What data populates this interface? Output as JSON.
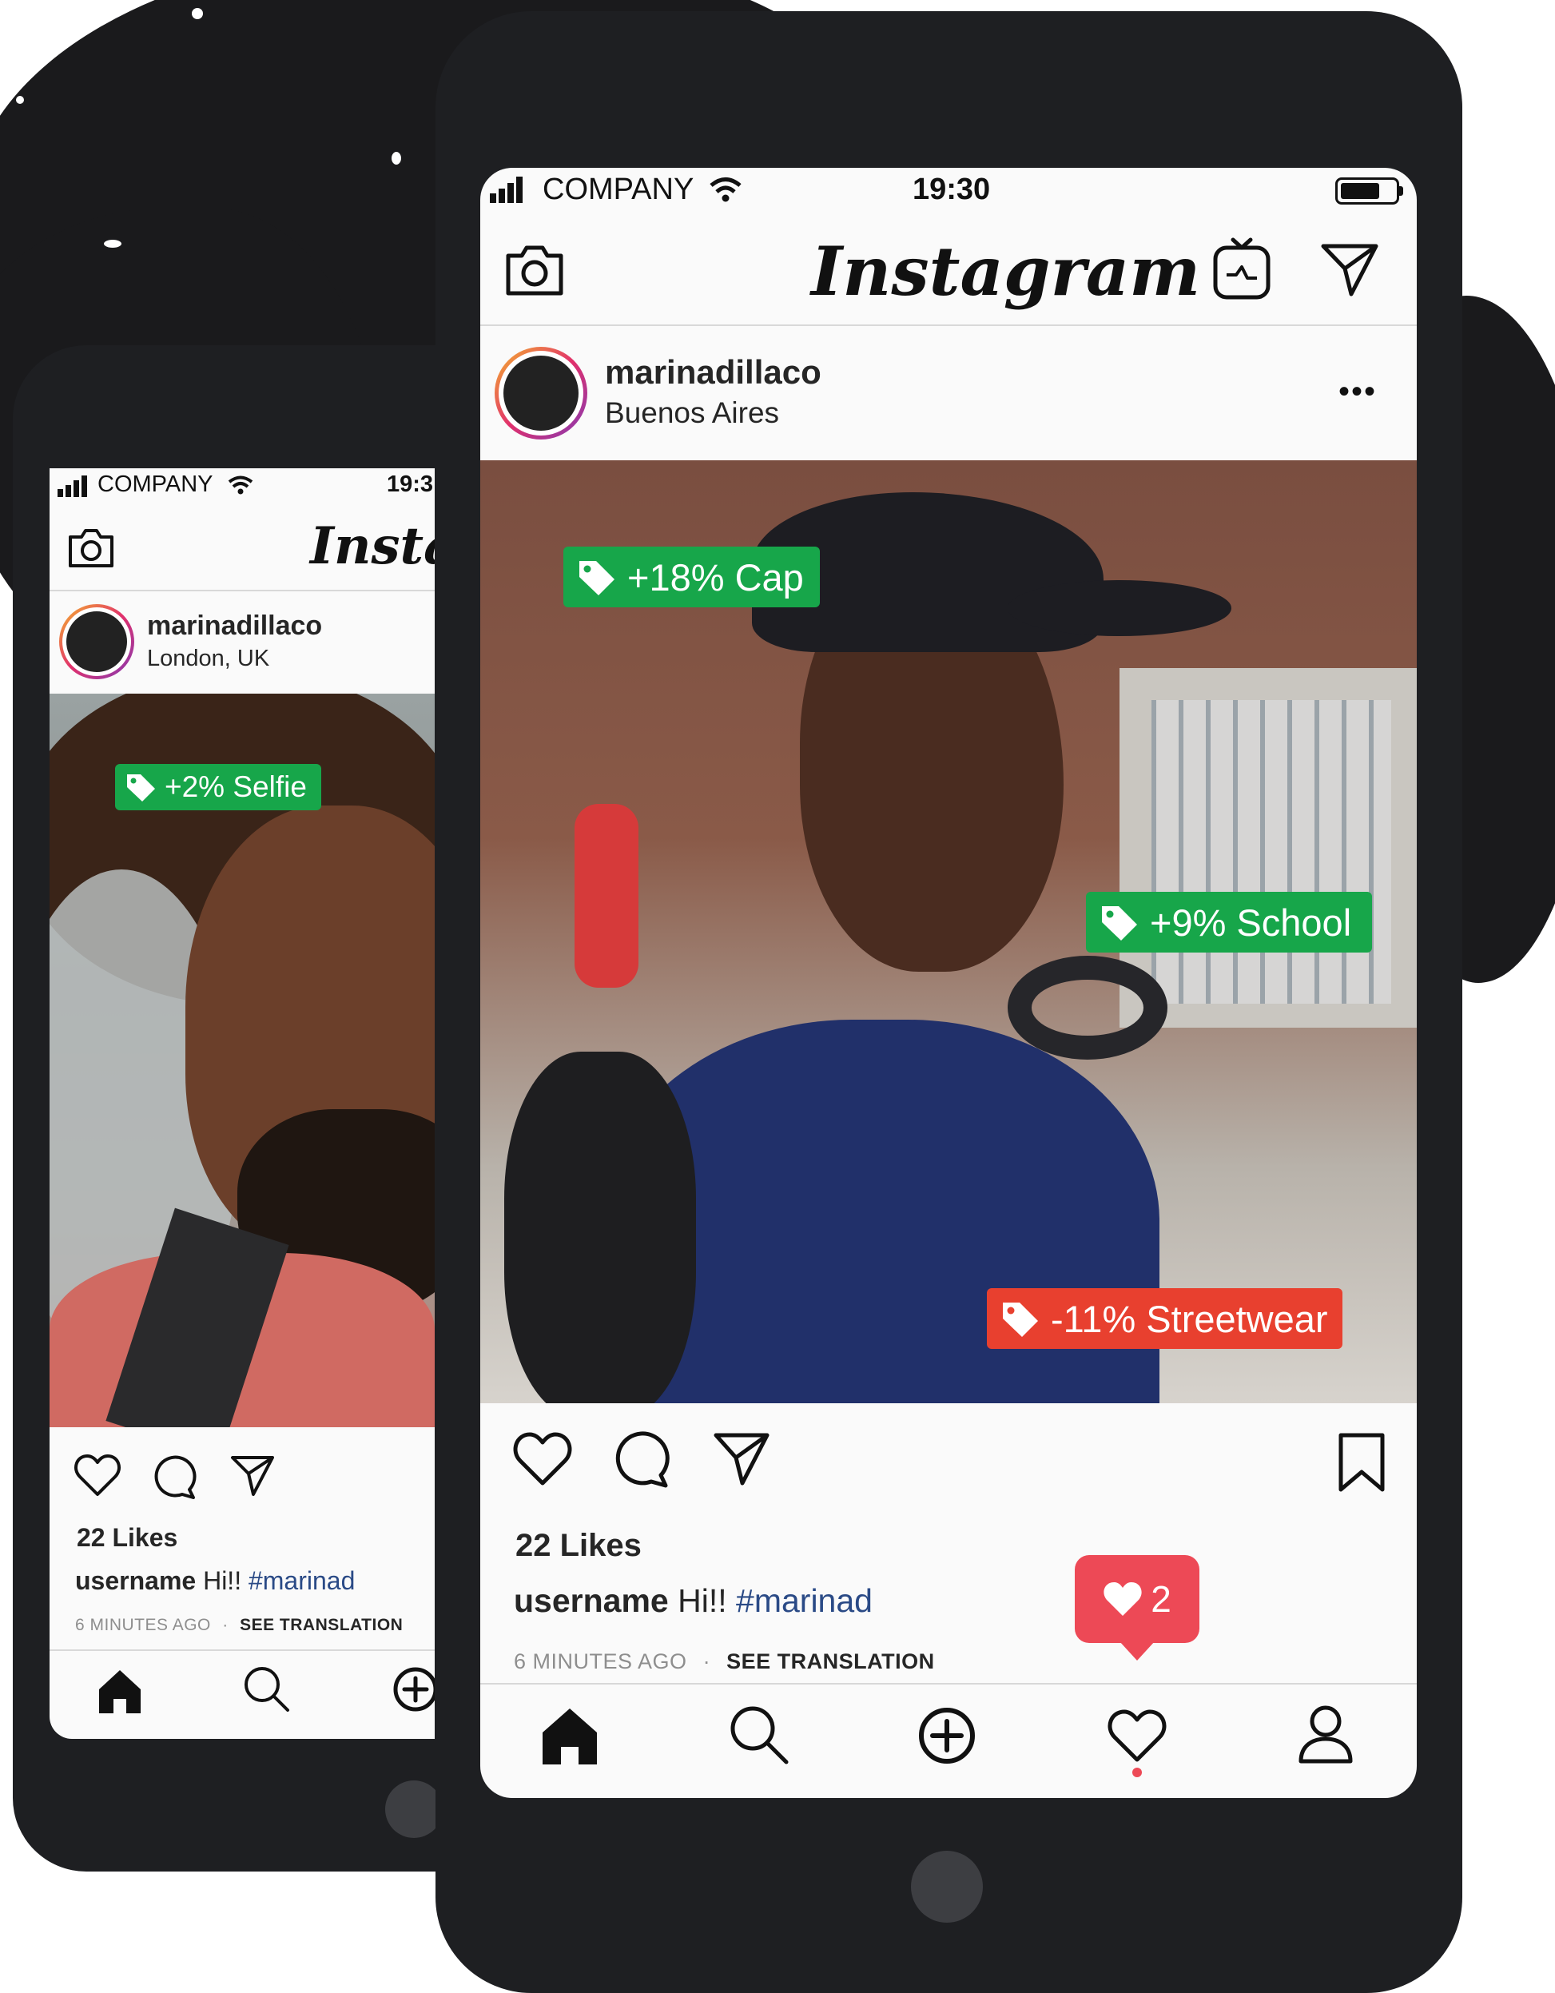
{
  "colors": {
    "tag_green": "#17a64a",
    "tag_red": "#e8402f",
    "notification": "#ed4956",
    "phone_body": "#1e1f22",
    "hashtag": "#2a4a86"
  },
  "back_phone": {
    "status": {
      "carrier": "COMPANY",
      "time": "19:3"
    },
    "app_logo": "Instag",
    "post": {
      "username": "marinadillaco",
      "location": "London, UK",
      "tags": [
        {
          "label": "+2% Selfie",
          "color": "green"
        }
      ],
      "likes": "22 Likes",
      "caption_user": "username",
      "caption_text": "Hi!!",
      "caption_hashtag": "#marinad",
      "time_ago": "6 MINUTES AGO",
      "separator": "·",
      "see_translation": "SEE TRANSLATION"
    },
    "bottom_nav": [
      "home-icon",
      "search-icon",
      "add-post-icon"
    ]
  },
  "front_phone": {
    "status": {
      "carrier": "COMPANY",
      "time": "19:30"
    },
    "app_logo": "Instagram",
    "header_icons": [
      "camera-icon",
      "igtv-icon",
      "direct-message-icon"
    ],
    "post": {
      "username": "marinadillaco",
      "location": "Buenos Aires",
      "more_label": "•••",
      "tags": [
        {
          "label": "+18% Cap",
          "color": "green"
        },
        {
          "label": "+9% School",
          "color": "green"
        },
        {
          "label": "-11% Streetwear",
          "color": "red"
        }
      ],
      "likes": "22 Likes",
      "caption_user": "username",
      "caption_text": "Hi!!",
      "caption_hashtag": "#marinad",
      "time_ago": "6 MINUTES AGO",
      "separator": "·",
      "see_translation": "SEE TRANSLATION"
    },
    "notification": {
      "icon": "heart-icon",
      "count": "2"
    },
    "bottom_nav": [
      "home-icon",
      "search-icon",
      "add-post-icon",
      "activity-heart-icon",
      "profile-icon"
    ]
  }
}
